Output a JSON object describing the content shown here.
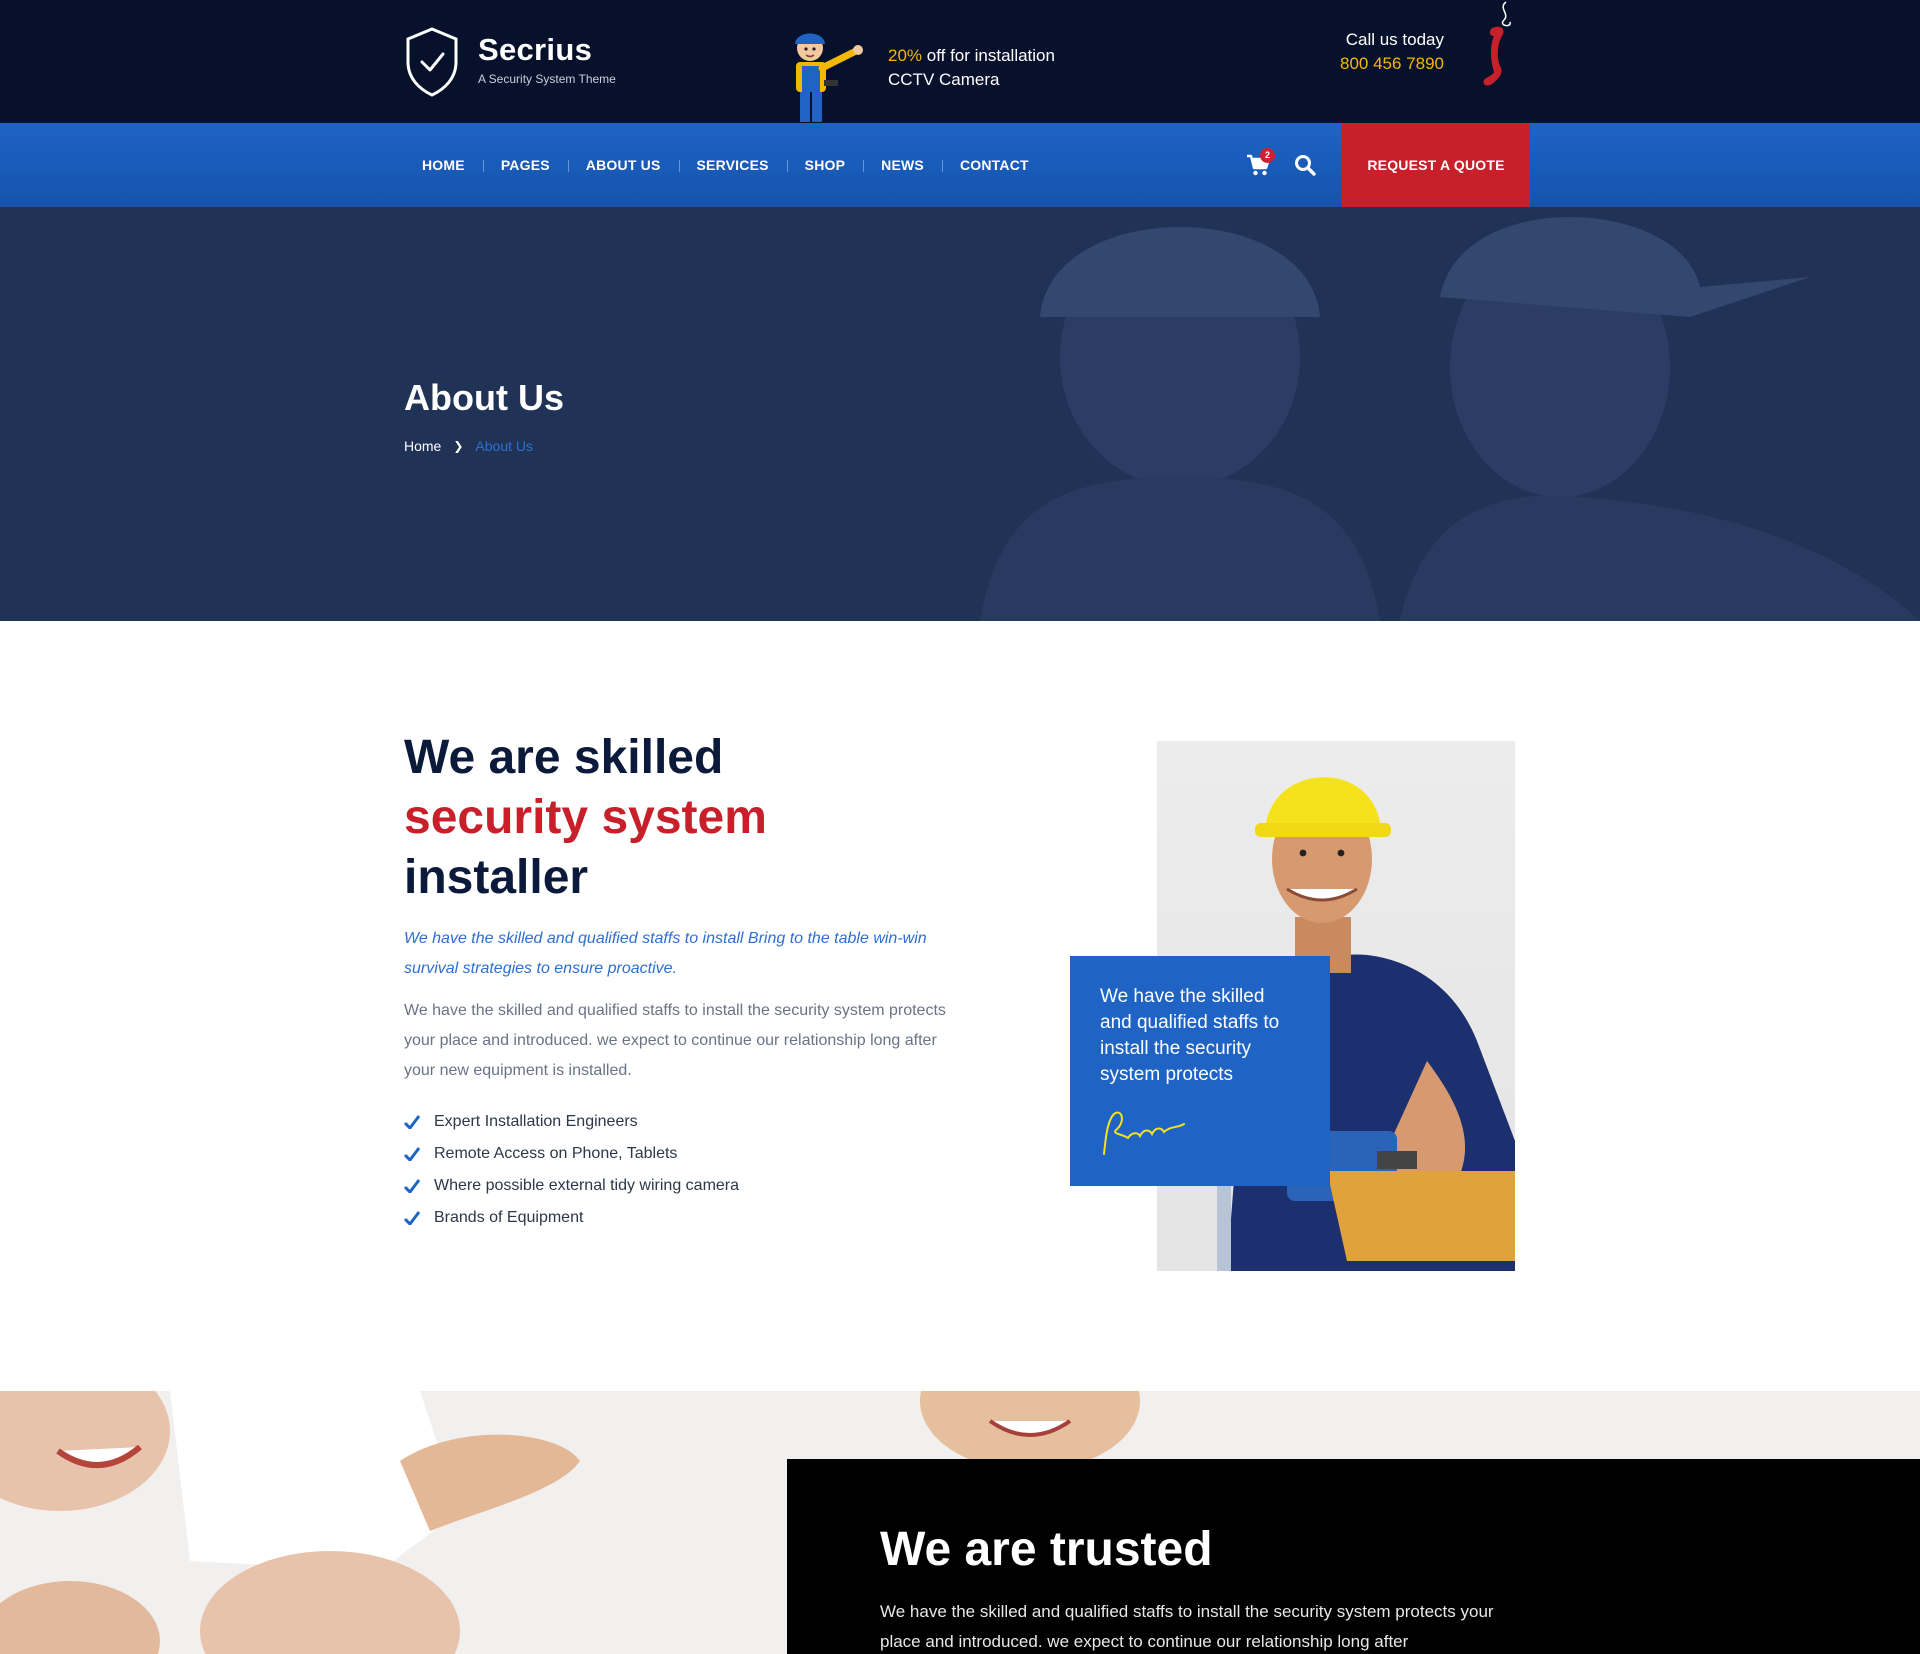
{
  "brand": {
    "name": "Secrius",
    "tagline": "A Security System Theme"
  },
  "promo": {
    "accent": "20%",
    "line1_rest": " off for installation",
    "line2": "CCTV Camera"
  },
  "contact": {
    "label": "Call us today",
    "phone": "800 456 7890"
  },
  "nav": {
    "items": [
      {
        "label": "HOME"
      },
      {
        "label": "PAGES"
      },
      {
        "label": "ABOUT US"
      },
      {
        "label": "SERVICES"
      },
      {
        "label": "SHOP"
      },
      {
        "label": "NEWS"
      },
      {
        "label": "CONTACT"
      }
    ],
    "cart_count": "2",
    "quote_label": "REQUEST A QUOTE"
  },
  "hero": {
    "title": "About Us",
    "breadcrumb": {
      "home": "Home",
      "current": "About Us"
    }
  },
  "about": {
    "heading_line1": "We are skilled",
    "heading_line2": "security system",
    "heading_line3": "installer",
    "lead": "We have the skilled and qualified staffs to install Bring to the table win-win survival strategies to ensure proactive.",
    "body": "We have the skilled and qualified staffs to install the security system protects your place and introduced. we expect to continue our relationship long after your new equipment is installed.",
    "features": [
      "Expert Installation Engineers",
      "Remote Access on Phone, Tablets",
      "Where possible external tidy wiring camera",
      "Brands of Equipment"
    ],
    "card_text": "We have the skilled and qualified staffs to install the security system protects"
  },
  "trusted": {
    "title": "We are trusted",
    "body": "We have the skilled and qualified staffs to install the security system protects your place and introduced. we expect to continue our relationship long after"
  },
  "colors": {
    "topbar": "#07112b",
    "nav_blue": "#1f63c5",
    "accent_red": "#c8202b",
    "accent_yellow": "#f5b800",
    "hero_overlay": "#213257"
  },
  "icons": {
    "logo": "shield-check-icon",
    "phone": "phone-icon",
    "cart": "cart-icon",
    "search": "search-icon",
    "check": "check-icon"
  }
}
